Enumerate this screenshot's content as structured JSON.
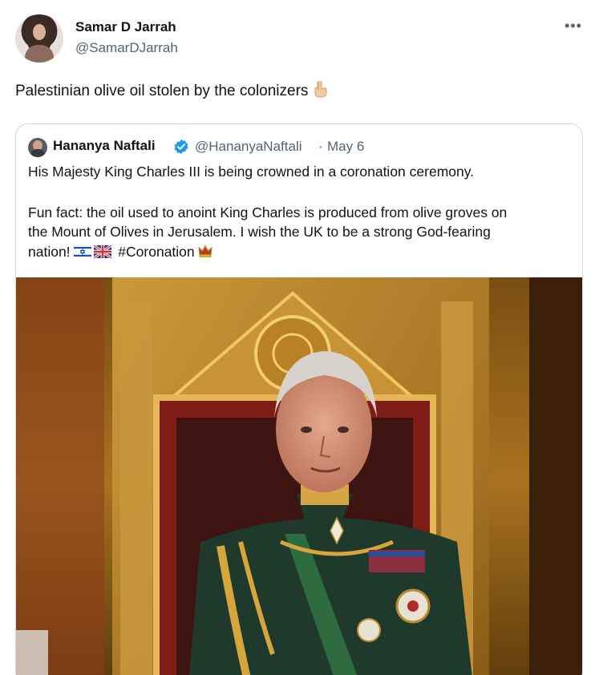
{
  "tweet": {
    "author_name": "Samar D Jarrah",
    "author_handle": "@SamarDJarrah",
    "more_label": "•••",
    "text": "Palestinian olive oil stolen by the colonizers"
  },
  "quote": {
    "author_name": "Hananya Naftali",
    "author_handle": "@HananyaNaftali",
    "separator": "·",
    "date": "May 6",
    "line1": "His Majesty King Charles III is being crowned in a coronation ceremony.",
    "line2": "Fun fact: the oil used to anoint King Charles is produced from olive groves on",
    "line3": "the Mount of Olives in Jerusalem. I wish the UK to be a strong God-fearing",
    "line4_pre": "nation!",
    "line4_tag": "#Coronation"
  },
  "icons": {
    "pointing_down": "backhand-index-pointing-down-icon",
    "verified": "verified-badge-icon",
    "israel_flag": "israel-flag-icon",
    "uk_flag": "uk-flag-icon",
    "crown": "crown-icon"
  },
  "colors": {
    "text": "#0f1419",
    "secondary": "#536471",
    "verified": "#1d9bf0",
    "border": "#cfd9de"
  }
}
